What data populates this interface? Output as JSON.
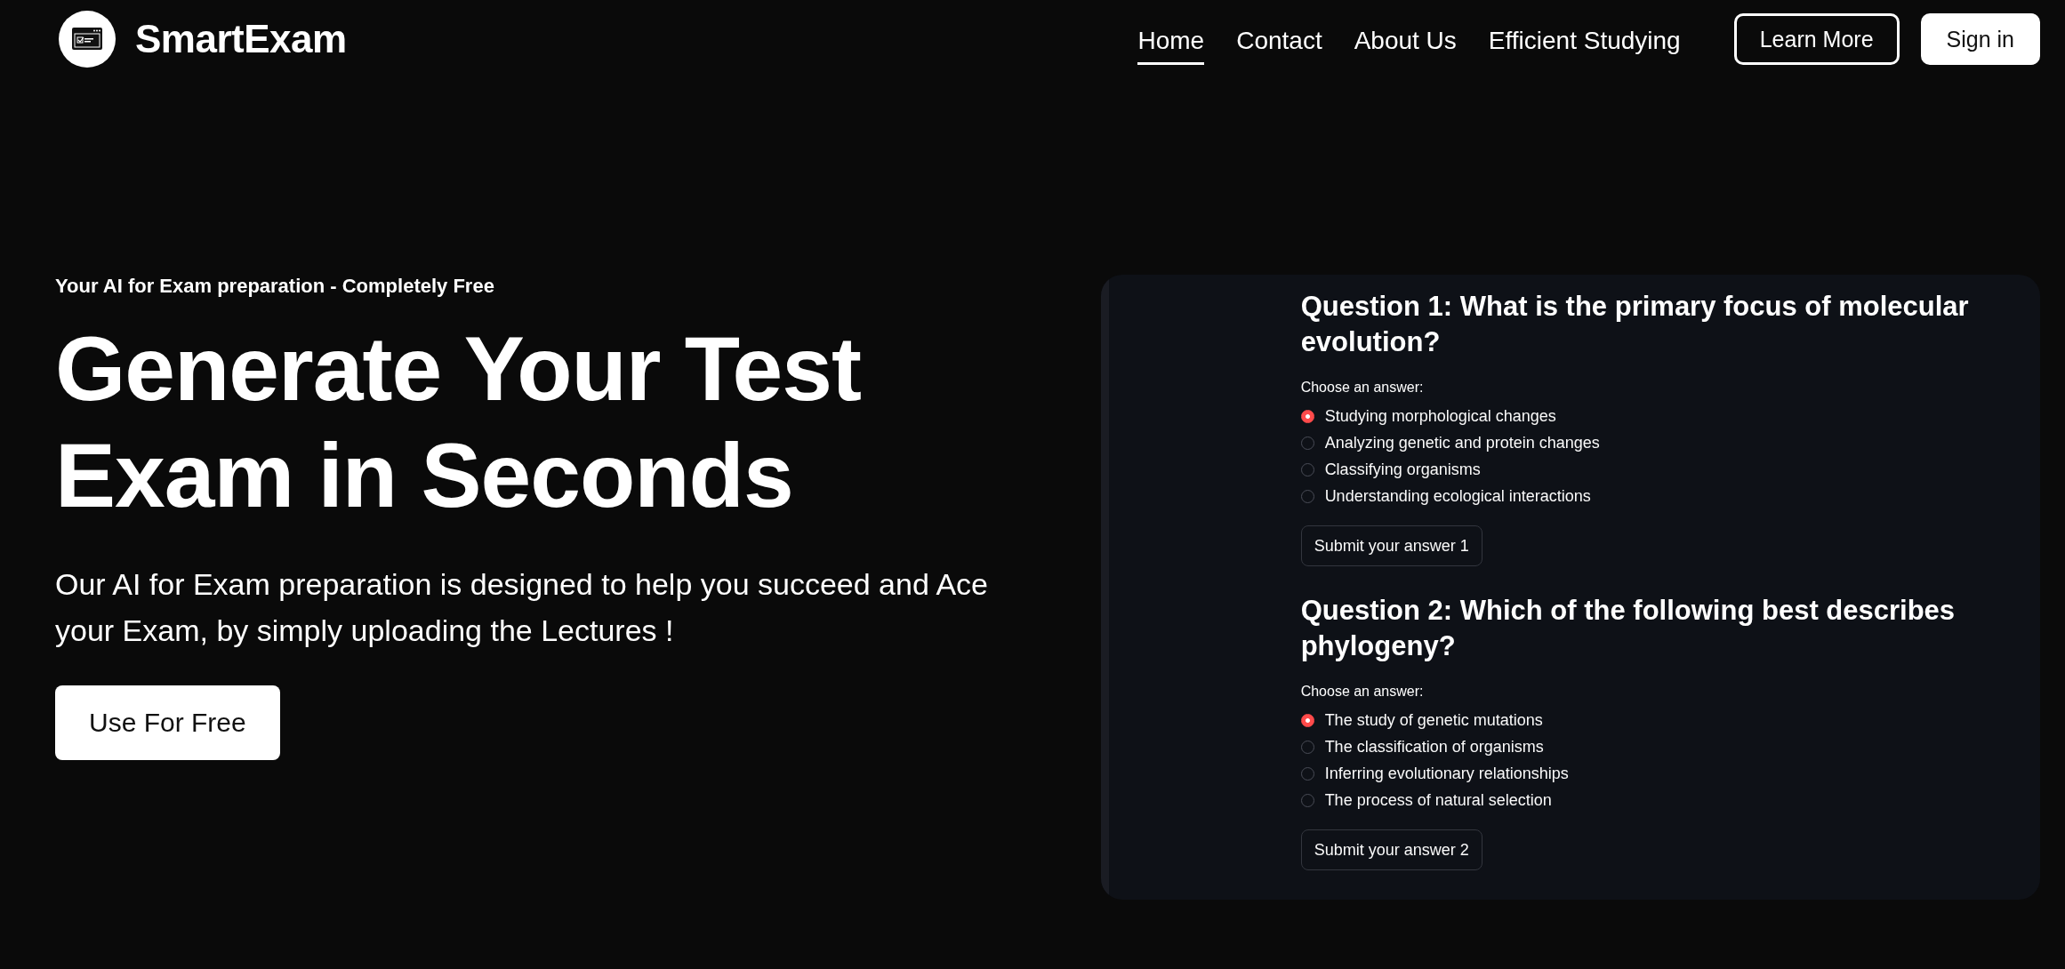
{
  "header": {
    "brand": "SmartExam",
    "nav": [
      {
        "label": "Home",
        "selected": true
      },
      {
        "label": "Contact",
        "selected": false
      },
      {
        "label": "About Us",
        "selected": false
      },
      {
        "label": "Efficient Studying",
        "selected": false
      }
    ],
    "buttons": [
      {
        "label": "Learn More",
        "kind": "outline"
      },
      {
        "label": "Sign in",
        "kind": "solid"
      }
    ]
  },
  "hero": {
    "tagline": "Your AI for Exam preparation - Completely Free",
    "headline": "Generate Your Test Exam in Seconds",
    "description": "Our AI for Exam preparation is designed to help you succeed and Ace your Exam, by simply uploading the Lectures !",
    "cta": "Use For Free"
  },
  "quiz": {
    "questions": [
      {
        "title": "Question 1: What is the primary focus of molecular evolution?",
        "prompt": "Choose an answer:",
        "options": [
          {
            "label": "Studying morphological changes",
            "selected": true
          },
          {
            "label": "Analyzing genetic and protein changes",
            "selected": false
          },
          {
            "label": "Classifying organisms",
            "selected": false
          },
          {
            "label": "Understanding ecological interactions",
            "selected": false
          }
        ],
        "submit": "Submit your answer 1"
      },
      {
        "title": "Question 2: Which of the following best describes phylogeny?",
        "prompt": "Choose an answer:",
        "options": [
          {
            "label": "The study of genetic mutations",
            "selected": true
          },
          {
            "label": "The classification of organisms",
            "selected": false
          },
          {
            "label": "Inferring evolutionary relationships",
            "selected": false
          },
          {
            "label": "The process of natural selection",
            "selected": false
          }
        ],
        "submit": "Submit your answer 2"
      }
    ]
  }
}
